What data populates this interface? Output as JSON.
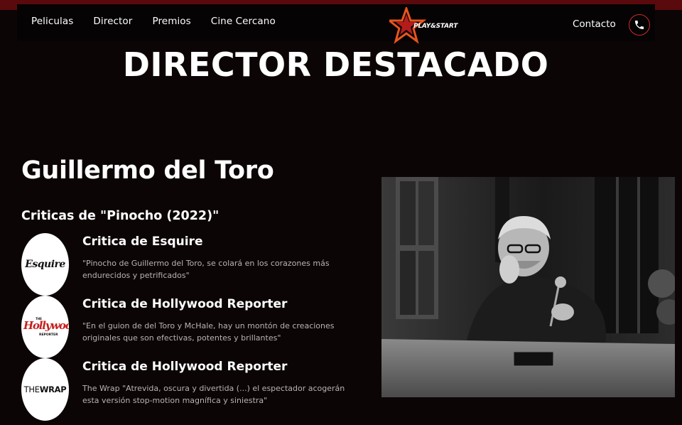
{
  "nav": {
    "links": [
      "Peliculas",
      "Director",
      "Premios",
      "Cine Cercano"
    ],
    "logo_text": "PLAY&START",
    "contact_label": "Contacto",
    "phone_icon": "phone-icon"
  },
  "headline": "DIRECTOR DESTACADO",
  "director": {
    "name": "Guillermo del Toro",
    "reviews_title": "Criticas de \"Pinocho (2022)\""
  },
  "reviews": [
    {
      "logo_text": "Esquire",
      "title": "Critica de Esquire",
      "quote": "\"Pinocho de Guillermo del Toro, se colará en los corazones más endurecidos y petrificados\""
    },
    {
      "logo_text": "Hollywood",
      "logo_small_top": "THE",
      "logo_small_bottom": "REPORTER",
      "title": "Critica de Hollywood Reporter",
      "quote": "\"En el guion de del Toro y McHale, hay un montón de creaciones originales que son efectivas, potentes y brillantes\""
    },
    {
      "logo_text_a": "THE",
      "logo_text_b": "WRAP",
      "title": "Critica de Hollywood Reporter",
      "quote": "The Wrap \"Atrevida, oscura y divertida (...) el espectador acogerán esta versión stop-motion magnífica y siniestra\""
    }
  ],
  "colors": {
    "background": "#0c0506",
    "accent": "#d22a2a",
    "logo_orange": "#e8541e"
  }
}
